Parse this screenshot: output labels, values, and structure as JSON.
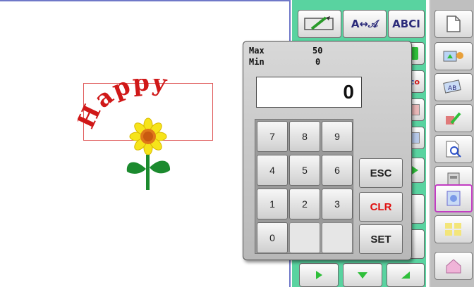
{
  "toolbar": {
    "text_arrange_label": "A↔𝒜",
    "font_label": "ABCI"
  },
  "design": {
    "text": "Happy"
  },
  "keypad": {
    "max_label": "Max",
    "max_value": "50",
    "min_label": "Min",
    "min_value": "0",
    "display_value": "0",
    "keys": [
      "7",
      "8",
      "9",
      "4",
      "5",
      "6",
      "1",
      "2",
      "3",
      "0"
    ],
    "esc_label": "ESC",
    "clr_label": "CLR",
    "set_label": "SET"
  },
  "colors": {
    "toolbar_green": "#59d3a0",
    "canvas_border": "#6f78c8",
    "clr_red": "#e01010",
    "text_red": "#d01818",
    "selection_magenta": "#c23cc2"
  },
  "icons": [
    "pencil-frame-icon",
    "text-arrange-icon",
    "font-icon",
    "new-page-icon",
    "import-design-icon",
    "letter-design-icon",
    "edit-design-icon",
    "preview-icon",
    "display-icon",
    "embroidery-select-icon",
    "layout-icon",
    "home-icon",
    "arrow-right-icon",
    "arrow-down-icon",
    "arrow-upleft-icon"
  ]
}
